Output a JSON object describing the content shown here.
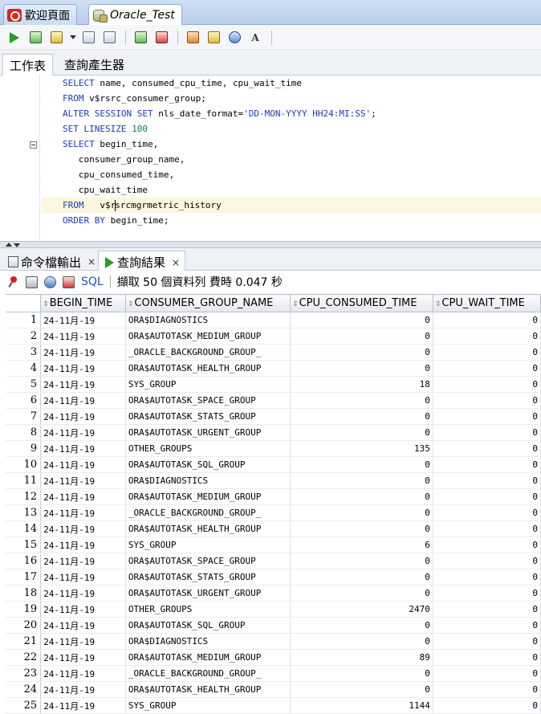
{
  "doc_tabs": [
    {
      "label": "歡迎頁面",
      "icon": "oracle-home-icon"
    },
    {
      "label": "Oracle_Test",
      "icon": "database-connection-icon"
    }
  ],
  "worksheet_tabs": {
    "worksheet": "工作表",
    "query_builder": "查詢產生器"
  },
  "editor": {
    "lines": [
      "SELECT name, consumed_cpu_time, cpu_wait_time",
      "FROM v$rsrc_consumer_group;",
      "ALTER SESSION SET nls_date_format='DD-MON-YYYY HH24:MI:SS';",
      "SET LINESIZE 100",
      "SELECT begin_time,",
      "   consumer_group_name,",
      "   cpu_consumed_time,",
      "   cpu_wait_time",
      "FROM   v$rsrcmgrmetric_history",
      "ORDER BY begin_time;"
    ]
  },
  "output_tabs": {
    "script_output": "命令檔輸出",
    "query_result": "查詢結果",
    "close": "×"
  },
  "results_toolbar": {
    "sql_label": "SQL",
    "status": "擷取 50 個資料列 費時 0.047 秒"
  },
  "grid": {
    "columns": [
      "BEGIN_TIME",
      "CONSUMER_GROUP_NAME",
      "CPU_CONSUMED_TIME",
      "CPU_WAIT_TIME"
    ],
    "rows": [
      [
        "1",
        "24-11月-19",
        "ORA$DIAGNOSTICS",
        "0",
        "0"
      ],
      [
        "2",
        "24-11月-19",
        "ORA$AUTOTASK_MEDIUM_GROUP",
        "0",
        "0"
      ],
      [
        "3",
        "24-11月-19",
        "_ORACLE_BACKGROUND_GROUP_",
        "0",
        "0"
      ],
      [
        "4",
        "24-11月-19",
        "ORA$AUTOTASK_HEALTH_GROUP",
        "0",
        "0"
      ],
      [
        "5",
        "24-11月-19",
        "SYS_GROUP",
        "18",
        "0"
      ],
      [
        "6",
        "24-11月-19",
        "ORA$AUTOTASK_SPACE_GROUP",
        "0",
        "0"
      ],
      [
        "7",
        "24-11月-19",
        "ORA$AUTOTASK_STATS_GROUP",
        "0",
        "0"
      ],
      [
        "8",
        "24-11月-19",
        "ORA$AUTOTASK_URGENT_GROUP",
        "0",
        "0"
      ],
      [
        "9",
        "24-11月-19",
        "OTHER_GROUPS",
        "135",
        "0"
      ],
      [
        "10",
        "24-11月-19",
        "ORA$AUTOTASK_SQL_GROUP",
        "0",
        "0"
      ],
      [
        "11",
        "24-11月-19",
        "ORA$DIAGNOSTICS",
        "0",
        "0"
      ],
      [
        "12",
        "24-11月-19",
        "ORA$AUTOTASK_MEDIUM_GROUP",
        "0",
        "0"
      ],
      [
        "13",
        "24-11月-19",
        "_ORACLE_BACKGROUND_GROUP_",
        "0",
        "0"
      ],
      [
        "14",
        "24-11月-19",
        "ORA$AUTOTASK_HEALTH_GROUP",
        "0",
        "0"
      ],
      [
        "15",
        "24-11月-19",
        "SYS_GROUP",
        "6",
        "0"
      ],
      [
        "16",
        "24-11月-19",
        "ORA$AUTOTASK_SPACE_GROUP",
        "0",
        "0"
      ],
      [
        "17",
        "24-11月-19",
        "ORA$AUTOTASK_STATS_GROUP",
        "0",
        "0"
      ],
      [
        "18",
        "24-11月-19",
        "ORA$AUTOTASK_URGENT_GROUP",
        "0",
        "0"
      ],
      [
        "19",
        "24-11月-19",
        "OTHER_GROUPS",
        "2470",
        "0"
      ],
      [
        "20",
        "24-11月-19",
        "ORA$AUTOTASK_SQL_GROUP",
        "0",
        "0"
      ],
      [
        "21",
        "24-11月-19",
        "ORA$DIAGNOSTICS",
        "0",
        "0"
      ],
      [
        "22",
        "24-11月-19",
        "ORA$AUTOTASK_MEDIUM_GROUP",
        "89",
        "0"
      ],
      [
        "23",
        "24-11月-19",
        "_ORACLE_BACKGROUND_GROUP_",
        "0",
        "0"
      ],
      [
        "24",
        "24-11月-19",
        "ORA$AUTOTASK_HEALTH_GROUP",
        "0",
        "0"
      ],
      [
        "25",
        "24-11月-19",
        "SYS_GROUP",
        "1144",
        "0"
      ]
    ]
  }
}
